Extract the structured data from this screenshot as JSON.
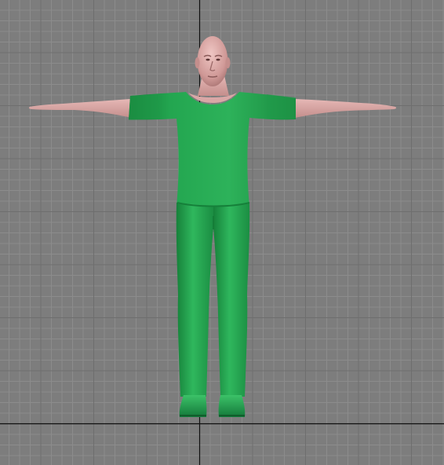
{
  "viewport": {
    "background_color": "#7d7d7d",
    "grid_minor_color": "#8c8c8c",
    "grid_major_color": "#6e6e6e",
    "axis_color": "#101010"
  },
  "model": {
    "pose": "T-pose",
    "skin_color": "#d9a7a6",
    "skin_shadow_color": "#a87372",
    "clothing_color": "#22a54e",
    "clothing_shadow_color": "#137a36",
    "clothing_highlight_color": "#3cc268"
  }
}
